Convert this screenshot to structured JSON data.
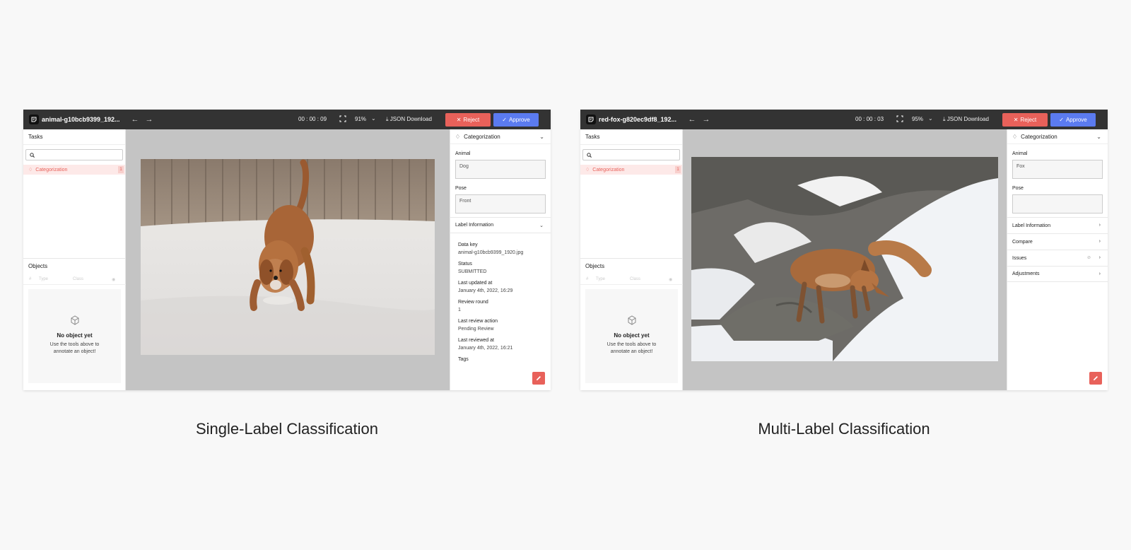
{
  "panels": [
    {
      "title": "animal-g10bcb9399_192...",
      "timer": "00 : 00 : 09",
      "zoom": "91%",
      "json_download": "JSON Download",
      "reject": "Reject",
      "approve": "Approve",
      "tasks_title": "Tasks",
      "search_placeholder": "",
      "task_label": "Categorization",
      "task_count": "1",
      "objects_title": "Objects",
      "obj_cols": [
        "#",
        "Type",
        "Class"
      ],
      "no_object_title": "No object yet",
      "no_object_line1": "Use the tools above to",
      "no_object_line2": "annotate an object!",
      "cat_title": "Categorization",
      "animal_label": "Animal",
      "animal_value": "Dog",
      "pose_label": "Pose",
      "pose_value": "Front",
      "label_info": "Label Information",
      "info": [
        {
          "k": "Data key",
          "v": "animal-g10bcb9399_1920.jpg"
        },
        {
          "k": "Status",
          "v": "SUBMITTED"
        },
        {
          "k": "Last updated at",
          "v": "January 4th, 2022, 16:29"
        },
        {
          "k": "Review round",
          "v": "1"
        },
        {
          "k": "Last review action",
          "v": "Pending Review"
        },
        {
          "k": "Last reviewed at",
          "v": "January 4th, 2022, 16:21"
        },
        {
          "k": "Tags",
          "v": ""
        }
      ],
      "caption": "Single-Label Classification"
    },
    {
      "title": "red-fox-g820ec9df8_192...",
      "timer": "00 : 00 : 03",
      "zoom": "95%",
      "json_download": "JSON Download",
      "reject": "Reject",
      "approve": "Approve",
      "tasks_title": "Tasks",
      "search_placeholder": "",
      "task_label": "Categorization",
      "task_count": "1",
      "objects_title": "Objects",
      "obj_cols": [
        "#",
        "Type",
        "Class"
      ],
      "no_object_title": "No object yet",
      "no_object_line1": "Use the tools above to",
      "no_object_line2": "annotate an object!",
      "cat_title": "Categorization",
      "animal_label": "Animal",
      "animal_value": "Fox",
      "pose_label": "Pose",
      "pose_value": "",
      "sections": [
        "Label Information",
        "Compare",
        "Issues",
        "Adjustments"
      ],
      "caption": "Multi-Label Classification"
    }
  ],
  "colors": {
    "reject": "#e8615a",
    "approve": "#5b7bf0",
    "topbar": "#333333",
    "canvas": "#c4c4c4",
    "task_highlight": "#fde9e8"
  },
  "icons": [
    "logo-icon",
    "arrow-left-icon",
    "arrow-right-icon",
    "fullscreen-icon",
    "chevron-down-icon",
    "download-icon",
    "close-icon",
    "check-icon",
    "search-icon",
    "tag-icon",
    "eye-icon",
    "eye-off-icon",
    "chevron-right-icon",
    "pencil-icon",
    "empty-object-icon"
  ]
}
